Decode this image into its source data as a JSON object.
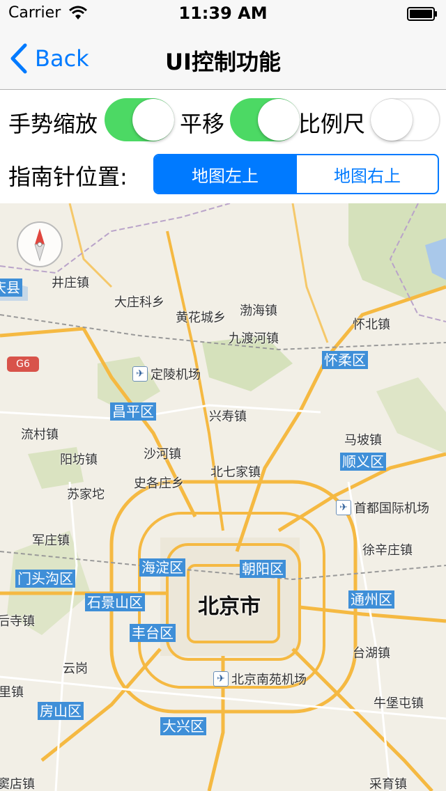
{
  "status": {
    "carrier": "Carrier",
    "time": "11:39 AM"
  },
  "nav": {
    "back_label": "Back",
    "title": "UI控制功能"
  },
  "controls": {
    "gesture_zoom": {
      "label": "手势缩放",
      "on": true
    },
    "pan": {
      "label": "平移",
      "on": true
    },
    "scale_bar": {
      "label": "比例尺",
      "on": false
    },
    "compass_position_label": "指南针位置:",
    "segments": [
      {
        "label": "地图左上",
        "selected": true
      },
      {
        "label": "地图右上",
        "selected": false
      }
    ]
  },
  "colors": {
    "accent": "#007aff",
    "switch_on": "#4cd964",
    "district_bg": "#3f8fd8",
    "road": "#f5b942",
    "park": "#c9dba8"
  },
  "map": {
    "road_shield": "G6",
    "city": "北京市",
    "districts": [
      "庆县",
      "怀柔区",
      "昌平区",
      "顺义区",
      "门头沟区",
      "海淀区",
      "朝阳区",
      "石景山区",
      "通州区",
      "丰台区",
      "房山区",
      "大兴区"
    ],
    "places": [
      "井庄镇",
      "大庄科乡",
      "黄花城乡",
      "渤海镇",
      "怀北镇",
      "九渡河镇",
      "兴寿镇",
      "流村镇",
      "沙河镇",
      "马坡镇",
      "阳坊镇",
      "北七家镇",
      "史各庄乡",
      "苏家坨",
      "军庄镇",
      "徐辛庄镇",
      "后寺镇",
      "台湖镇",
      "云岗",
      "里镇",
      "牛堡屯镇",
      "窦店镇",
      "采育镇"
    ],
    "airports": [
      "定陵机场",
      "首都国际机场",
      "北京南苑机场"
    ]
  }
}
